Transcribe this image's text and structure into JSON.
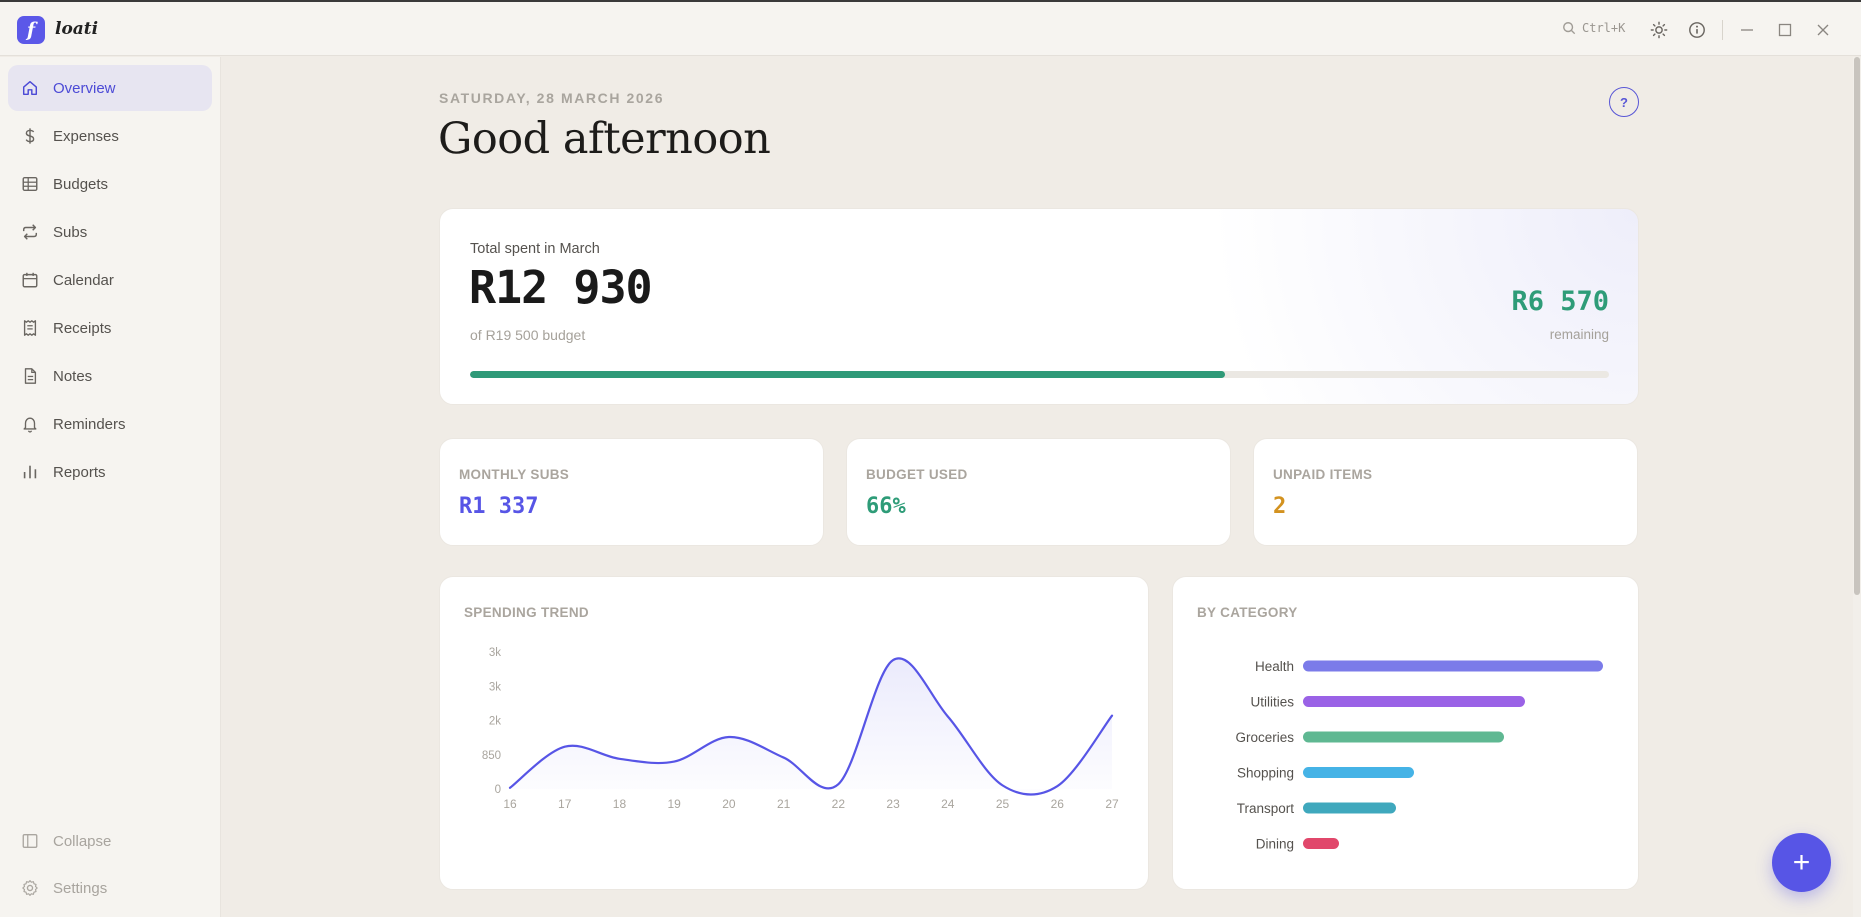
{
  "app": {
    "name": "loati",
    "logo_letter": "f",
    "search_hint": "Ctrl+K"
  },
  "sidebar": {
    "items": [
      {
        "label": "Overview",
        "icon": "home-icon",
        "active": true
      },
      {
        "label": "Expenses",
        "icon": "dollar-icon"
      },
      {
        "label": "Budgets",
        "icon": "table-icon"
      },
      {
        "label": "Subs",
        "icon": "repeat-icon"
      },
      {
        "label": "Calendar",
        "icon": "calendar-icon"
      },
      {
        "label": "Receipts",
        "icon": "receipt-icon"
      },
      {
        "label": "Notes",
        "icon": "note-icon"
      },
      {
        "label": "Reminders",
        "icon": "bell-icon"
      },
      {
        "label": "Reports",
        "icon": "bar-chart-icon"
      }
    ],
    "collapse_label": "Collapse",
    "settings_label": "Settings"
  },
  "header": {
    "date": "SATURDAY, 28 MARCH 2026",
    "greeting": "Good afternoon",
    "help_label": "?"
  },
  "summary": {
    "label": "Total spent in March",
    "amount": "R12 930",
    "budget_text": "of R19 500 budget",
    "remaining": "R6 570",
    "remaining_label": "remaining",
    "progress": 0.663,
    "accent": "#2f9a78"
  },
  "stats": [
    {
      "label": "MONTHLY SUBS",
      "value": "R1 337",
      "color": "#5755e6"
    },
    {
      "label": "BUDGET USED",
      "value": "66%",
      "color": "#2e9c78"
    },
    {
      "label": "UNPAID ITEMS",
      "value": "2",
      "color": "#d3921f"
    }
  ],
  "trend": {
    "title": "SPENDING TREND",
    "chart_data": {
      "type": "area",
      "x": [
        "16",
        "17",
        "18",
        "19",
        "20",
        "21",
        "22",
        "23",
        "24",
        "25",
        "26",
        "27"
      ],
      "values": [
        30,
        1050,
        750,
        680,
        1290,
        780,
        120,
        3200,
        1800,
        90,
        70,
        1820
      ],
      "y_tick_labels": [
        "0",
        "850",
        "2k",
        "3k",
        "3k"
      ],
      "y_tick_values": [
        0,
        850,
        1700,
        2550,
        3400
      ],
      "ylim": [
        0,
        3400
      ],
      "color": "#5755e6"
    }
  },
  "categories": {
    "title": "BY CATEGORY",
    "chart_data": {
      "type": "bar",
      "orientation": "horizontal",
      "categories": [
        "Health",
        "Utilities",
        "Groceries",
        "Shopping",
        "Transport",
        "Dining"
      ],
      "values": [
        100,
        74,
        67,
        37,
        31,
        12
      ],
      "colors": [
        "#7b7be9",
        "#9a62e6",
        "#5fb892",
        "#45b3e6",
        "#3fa8bd",
        "#e1476b"
      ]
    }
  },
  "fab_label": "+"
}
